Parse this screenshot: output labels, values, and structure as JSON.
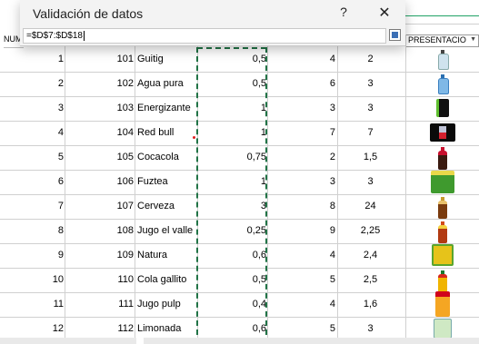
{
  "dialog": {
    "title": "Validación de datos",
    "help_label": "?",
    "close_label": "✕",
    "reference_value": "=$D$7:$D$18"
  },
  "headers": {
    "left": "NUM",
    "right": "PRESENTACIO",
    "right_arrow": "▼"
  },
  "rows": [
    {
      "num": "1",
      "id": "101",
      "name": "Guitig",
      "size": "0,5",
      "a": "4",
      "b": "2",
      "image": "water-bottle-icon"
    },
    {
      "num": "2",
      "id": "102",
      "name": "Agua pura",
      "size": "0,5",
      "a": "6",
      "b": "3",
      "image": "water-bottle-icon"
    },
    {
      "num": "3",
      "id": "103",
      "name": "Energizante",
      "size": "1",
      "a": "3",
      "b": "3",
      "image": "energy-can-icon"
    },
    {
      "num": "4",
      "id": "104",
      "name": "Red bull",
      "size": "1",
      "a": "7",
      "b": "7",
      "image": "redbull-can-icon"
    },
    {
      "num": "5",
      "id": "105",
      "name": "Cocacola",
      "size": "0,75",
      "a": "2",
      "b": "1,5",
      "image": "cola-bottle-icon"
    },
    {
      "num": "6",
      "id": "106",
      "name": "Fuztea",
      "size": "1",
      "a": "3",
      "b": "3",
      "image": "tea-pack-icon"
    },
    {
      "num": "7",
      "id": "107",
      "name": "Cerveza",
      "size": "3",
      "a": "8",
      "b": "24",
      "image": "beer-bottle-icon"
    },
    {
      "num": "8",
      "id": "108",
      "name": "Jugo el valle",
      "size": "0,25",
      "a": "9",
      "b": "2,25",
      "image": "juice-bottle-icon"
    },
    {
      "num": "9",
      "id": "109",
      "name": "Natura",
      "size": "0,6",
      "a": "4",
      "b": "2,4",
      "image": "juice-box-icon"
    },
    {
      "num": "10",
      "id": "110",
      "name": "Cola gallito",
      "size": "0,5",
      "a": "5",
      "b": "2,5",
      "image": "soda-bottle-icon"
    },
    {
      "num": "11",
      "id": "111",
      "name": "Jugo pulp",
      "size": "0,4",
      "a": "4",
      "b": "1,6",
      "image": "juice-carton-icon"
    },
    {
      "num": "12",
      "id": "112",
      "name": "Limonada",
      "size": "0,6",
      "a": "5",
      "b": "3",
      "image": "lemonade-bottle-icon"
    }
  ],
  "colors": {
    "selection_dash": "#217346",
    "accent": "#21a366"
  }
}
